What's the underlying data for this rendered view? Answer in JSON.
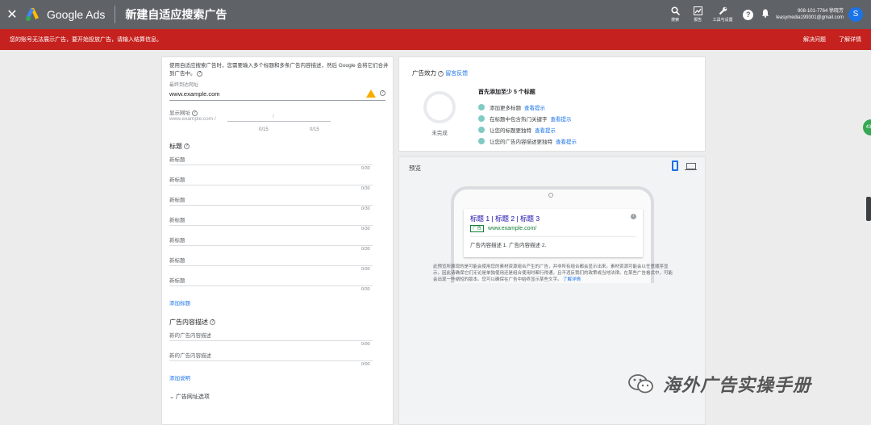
{
  "topbar": {
    "close_icon": "close-icon",
    "brand": "Google Ads",
    "title": "新建自适应搜索广告",
    "tools": [
      {
        "icon": "search-icon",
        "label": "搜索"
      },
      {
        "icon": "reports-icon",
        "label": "报告"
      },
      {
        "icon": "wrench-icon",
        "label": "工具与设置"
      }
    ],
    "account_line1": "908-101-7764 徐晓芳",
    "account_line2": "leasymedia199301@gmail.com",
    "avatar_letter": "S"
  },
  "alert": {
    "text": "您的账号无法展示广告，要开始投放广告，请输入结算信息。",
    "fix_label": "解决问题",
    "learn_label": "了解详情"
  },
  "form": {
    "intro": "使用自适应搜索广告时，您需要输入多个标题和多条广告内容描述，然后 Google 会将它们合并到广告中。",
    "final_url_label": "最终到达网址",
    "final_url_value": "www.example.com",
    "display_url_label": "显示网址",
    "display_url_value": "www.example.com /",
    "path_slash": "/",
    "path1_count": "0/15",
    "path2_count": "0/15",
    "headlines_title": "标题",
    "headlines": [
      {
        "placeholder": "新标题",
        "count": "0/30"
      },
      {
        "placeholder": "新标题",
        "count": "0/30"
      },
      {
        "placeholder": "新标题",
        "count": "0/30"
      },
      {
        "placeholder": "新标题",
        "count": "0/30"
      },
      {
        "placeholder": "新标题",
        "count": "0/30"
      },
      {
        "placeholder": "新标题",
        "count": "0/30"
      },
      {
        "placeholder": "新标题",
        "count": "0/30"
      }
    ],
    "add_headline": "添加标题",
    "descriptions_title": "广告内容描述",
    "descriptions": [
      {
        "placeholder": "新的广告内容描述",
        "count": "0/90"
      },
      {
        "placeholder": "新的广告内容描述",
        "count": "0/90"
      }
    ],
    "add_description": "添加说明",
    "url_options": "广告网址选项"
  },
  "effect": {
    "title": "广告效力",
    "feedback_link": "留言反馈",
    "status": "未完成",
    "first_add": "首先添加至少 5 个标题",
    "tips": [
      {
        "text": "添加更多标题",
        "link": "查看提示"
      },
      {
        "text": "在标题中包含热门关键字",
        "link": "查看提示"
      },
      {
        "text": "让您的标题更独特",
        "link": "查看提示"
      },
      {
        "text": "让您的广告内容描述更独特",
        "link": "查看提示"
      }
    ]
  },
  "preview": {
    "title": "预览",
    "ad_headline": "标题 1 | 标题 2 | 标题 3",
    "ad_badge": "广告",
    "ad_url": "www.example.com/",
    "ad_description": "广告内容描述 1. 广告内容描述 2.",
    "disclaimer": "此预览所展现的是可能会使用您的素材资源组合产生的广告，并非所有组合都会显示出来。素材资源可能会以任意顺序显示，因此请确保它们无论是单独使用还是组合使用时都行得通，且不违反我们的政策或当地法律。在某些广告格式中，可能会出现一些缩短的版本。您可以确保在广告中始终显示某些文字。",
    "disclaimer_link": "了解详情"
  },
  "side_badge": "43",
  "watermark": "海外广告实操手册",
  "colors": {
    "topbar": "#5f6368",
    "alert": "#c5221f",
    "link": "#1a73e8",
    "tip_dot": "#80cbc4"
  }
}
